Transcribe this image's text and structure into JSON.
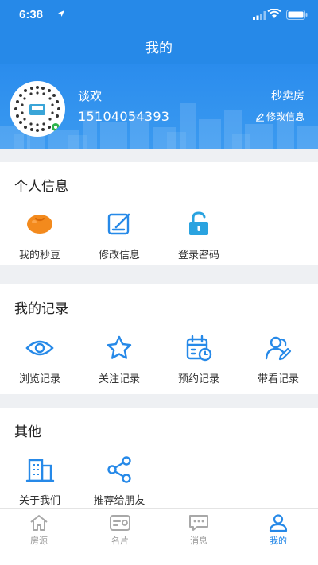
{
  "status": {
    "time": "6:38"
  },
  "nav": {
    "title": "我的"
  },
  "profile": {
    "name": "谈欢",
    "phone": "15104054393",
    "role": "秒卖房",
    "edit_label": "修改信息"
  },
  "personal": {
    "title": "个人信息",
    "items": [
      {
        "label": "我的秒豆",
        "icon": "bean-icon"
      },
      {
        "label": "修改信息",
        "icon": "edit-icon"
      },
      {
        "label": "登录密码",
        "icon": "lock-icon"
      }
    ]
  },
  "records": {
    "title": "我的记录",
    "items": [
      {
        "label": "浏览记录",
        "icon": "eye-icon"
      },
      {
        "label": "关注记录",
        "icon": "star-icon"
      },
      {
        "label": "预约记录",
        "icon": "calendar-clock-icon"
      },
      {
        "label": "带看记录",
        "icon": "users-edit-icon"
      }
    ]
  },
  "other": {
    "title": "其他",
    "items": [
      {
        "label": "关于我们",
        "icon": "building-icon"
      },
      {
        "label": "推荐给朋友",
        "icon": "share-icon"
      }
    ]
  },
  "tabs": [
    {
      "label": "房源",
      "icon": "house-icon",
      "active": false
    },
    {
      "label": "名片",
      "icon": "card-icon",
      "active": false
    },
    {
      "label": "消息",
      "icon": "message-icon",
      "active": false
    },
    {
      "label": "我的",
      "icon": "person-icon",
      "active": true
    }
  ],
  "colors": {
    "brand": "#2689e8",
    "accent_orange": "#f38a1d",
    "section_bg": "#eef0f3"
  }
}
